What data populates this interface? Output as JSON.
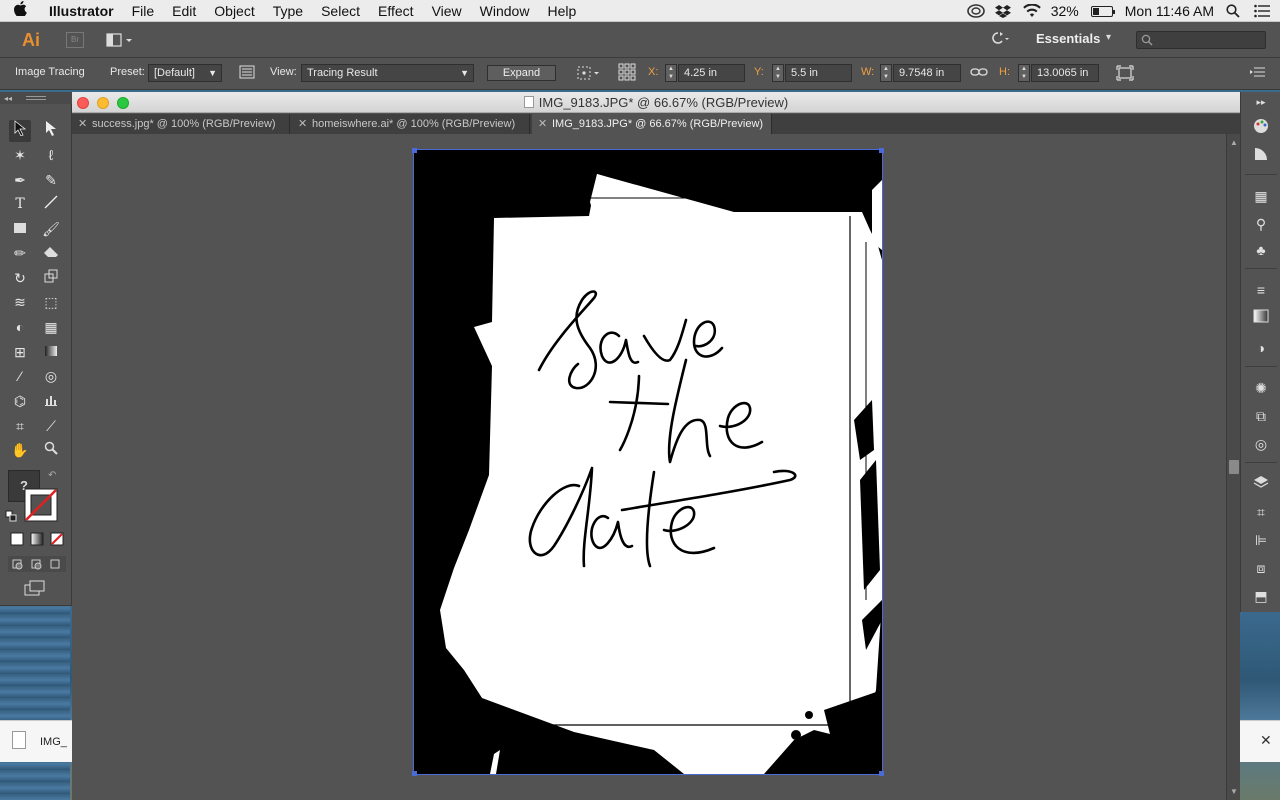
{
  "menubar": {
    "apple": "",
    "app_name": "Illustrator",
    "items": [
      "File",
      "Edit",
      "Object",
      "Type",
      "Select",
      "Effect",
      "View",
      "Window",
      "Help"
    ],
    "battery": "32%",
    "clock": "Mon 11:46 AM"
  },
  "appbar": {
    "logo": "Ai",
    "bridge": "Br",
    "workspace": "Essentials"
  },
  "controlbar": {
    "panel_label": "Image Tracing",
    "preset_label": "Preset:",
    "preset_value": "[Default]",
    "view_label": "View:",
    "view_value": "Tracing Result",
    "expand_label": "Expand",
    "x_label": "X:",
    "x_value": "4.25 in",
    "y_label": "Y:",
    "y_value": "5.5 in",
    "w_label": "W:",
    "w_value": "9.7548 in",
    "h_label": "H:",
    "h_value": "13.0065 in"
  },
  "document": {
    "title": "IMG_9183.JPG* @ 66.67% (RGB/Preview)",
    "tabs": [
      {
        "label": "success.jpg* @ 100% (RGB/Preview)"
      },
      {
        "label": "homeiswhere.ai* @ 100% (RGB/Preview)"
      },
      {
        "label": "IMG_9183.JPG* @ 66.67% (RGB/Preview)"
      }
    ]
  },
  "artwork": {
    "lettering": "save the date"
  },
  "tools": {
    "unknown_fill": "?"
  },
  "finder_strip": {
    "file_label": "IMG_"
  },
  "colors": {
    "panel_bg": "#535353",
    "selection": "#4a6ad8",
    "ai_orange": "#e8902e"
  }
}
